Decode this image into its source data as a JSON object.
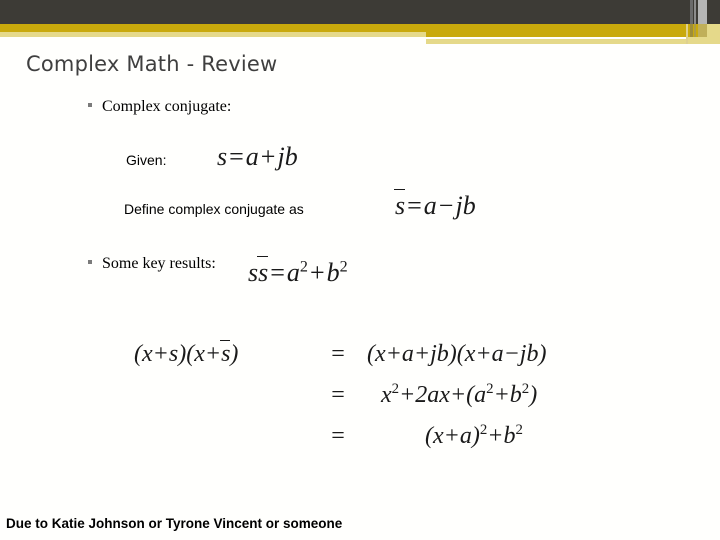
{
  "slide": {
    "title": "Complex Math - Review",
    "footer": "Due to Katie Johnson or Tyrone Vincent or someone"
  },
  "theme": {
    "banner_dark": "#3d3b36",
    "banner_gold": "#c9a90c",
    "banner_pale": "#e5d98a",
    "title_color": "#3f3f3f",
    "body_color": "#000000",
    "background": "#fffffd"
  },
  "content": {
    "bullet_1": "Complex conjugate:",
    "given_label": "Given:",
    "define_label": "Define complex conjugate as",
    "bullet_2": "Some key results:"
  },
  "equations": {
    "given": {
      "lhs_var": "s",
      "eq": "=",
      "term_a": "a",
      "plus": "+",
      "term_jb": "jb",
      "plain": "s = a + jb"
    },
    "conjugate": {
      "lhs_var": "s",
      "eq": "=",
      "term_a": "a",
      "minus": "−",
      "term_jb": "jb",
      "plain": "s̄ = a − jb"
    },
    "modulus": {
      "lhs_s": "s",
      "lhs_sbar": "s",
      "eq": "=",
      "term_a": "a",
      "exp_a": "2",
      "plus": "+",
      "term_b": "b",
      "exp_b": "2",
      "plain": "ss̄ = a² + b²"
    }
  },
  "derivation": {
    "rows": [
      {
        "lhs": "(x + s)(x + s̄)",
        "eq": "=",
        "rhs": "(x + a + jb)(x + a − jb)"
      },
      {
        "lhs": "",
        "eq": "=",
        "rhs": "x² + 2ax + (a² + b²)"
      },
      {
        "lhs": "",
        "eq": "=",
        "rhs": "(x + a)² + b²"
      }
    ],
    "tokens": {
      "lparen": "(",
      "rparen": ")",
      "x": "x",
      "plus": "+",
      "minus": "−",
      "s": "s",
      "a": "a",
      "b": "b",
      "jb": "jb",
      "two": "2",
      "ax": "ax",
      "exp2": "2",
      "eq": "="
    }
  }
}
